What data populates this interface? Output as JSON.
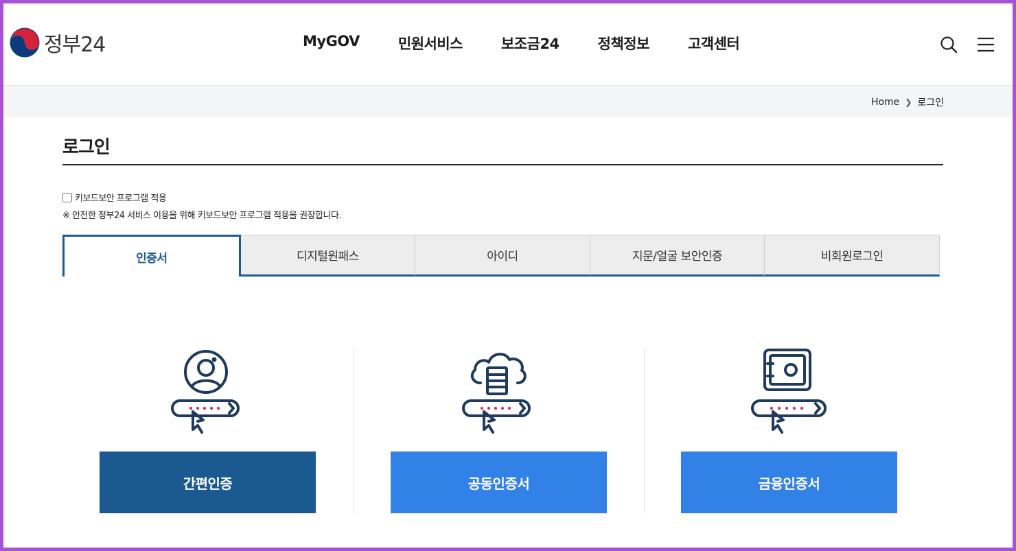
{
  "header": {
    "logo_text": "정부24",
    "nav": [
      "MyGOV",
      "민원서비스",
      "보조금24",
      "정책정보",
      "고객센터"
    ]
  },
  "breadcrumb": {
    "home": "Home",
    "current": "로그인"
  },
  "page": {
    "title": "로그인"
  },
  "keyboard_security": {
    "label": "키보드보안 프로그램 적용",
    "checked": false,
    "note": "※ 안전한 정부24 서비스 이용을 위해 키보드보안 프로그램 적용을 권장합니다."
  },
  "tabs": [
    {
      "label": "인증서",
      "active": true
    },
    {
      "label": "디지털원패스",
      "active": false
    },
    {
      "label": "아이디",
      "active": false
    },
    {
      "label": "지문/얼굴 보안인증",
      "active": false
    },
    {
      "label": "비회원로그인",
      "active": false
    }
  ],
  "cards": [
    {
      "icon": "user-login-icon",
      "label": "간편인증",
      "color": "#1b5a91"
    },
    {
      "icon": "cloud-server-login-icon",
      "label": "공동인증서",
      "color": "#3281e6"
    },
    {
      "icon": "safe-login-icon",
      "label": "금융인증서",
      "color": "#3281e6"
    }
  ],
  "colors": {
    "frame": "#a752d6",
    "primary_dark": "#1b5a91",
    "primary_light": "#3281e6",
    "icon_stroke": "#1f3a5b",
    "dot_red": "#e6214a"
  }
}
